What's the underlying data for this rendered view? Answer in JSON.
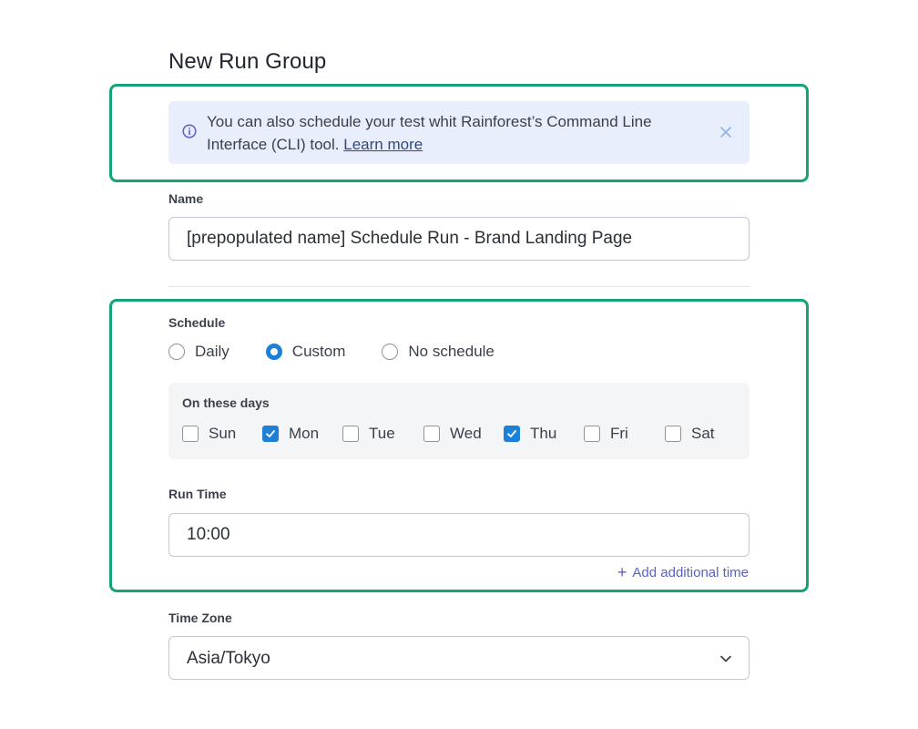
{
  "page": {
    "title": "New Run Group"
  },
  "banner": {
    "text": "You can also schedule your test whit Rainforest’s Command Line Interface (CLI) tool.",
    "link": "Learn more",
    "icon": "info-icon",
    "close_icon": "close-icon"
  },
  "name": {
    "label": "Name",
    "value": "[prepopulated name] Schedule Run - Brand Landing Page"
  },
  "schedule": {
    "label": "Schedule",
    "options": [
      {
        "label": "Daily",
        "selected": false
      },
      {
        "label": "Custom",
        "selected": true
      },
      {
        "label": "No schedule",
        "selected": false
      }
    ],
    "days": {
      "title": "On these days",
      "items": [
        {
          "label": "Sun",
          "checked": false
        },
        {
          "label": "Mon",
          "checked": true
        },
        {
          "label": "Tue",
          "checked": false
        },
        {
          "label": "Wed",
          "checked": false
        },
        {
          "label": "Thu",
          "checked": true
        },
        {
          "label": "Fri",
          "checked": false
        },
        {
          "label": "Sat",
          "checked": false
        }
      ]
    }
  },
  "run_time": {
    "label": "Run Time",
    "value": "10:00",
    "add_label": "Add additional time",
    "add_icon": "+"
  },
  "time_zone": {
    "label": "Time Zone",
    "value": "Asia/Tokyo",
    "icon": "chevron-down-icon"
  },
  "colors": {
    "accent": "#1e7fd6",
    "highlight": "#14a37a",
    "link": "#5b5fc7",
    "banner_bg": "#e9eefc"
  }
}
